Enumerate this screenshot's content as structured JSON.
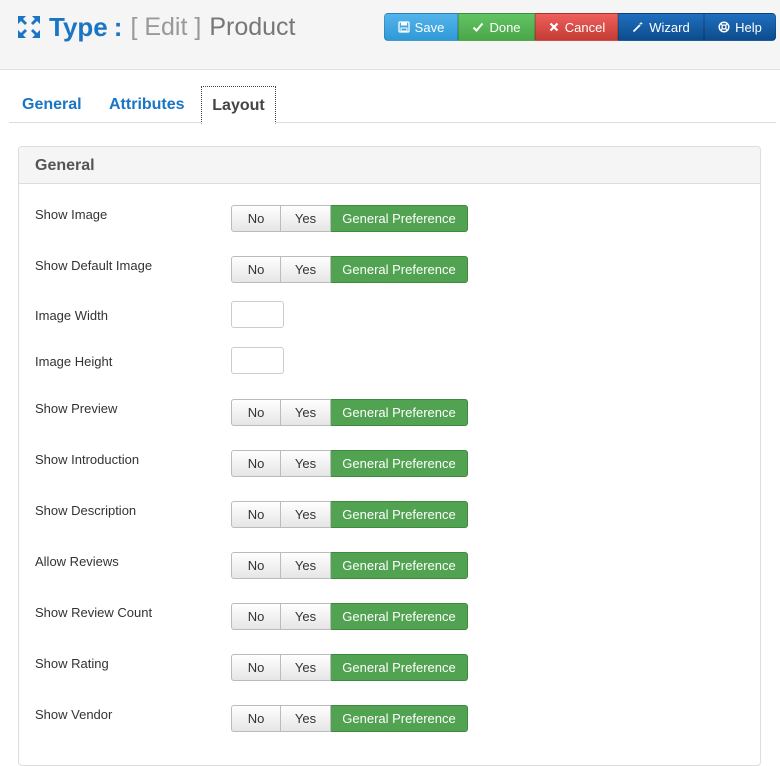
{
  "header": {
    "type_label": "Type",
    "colon": ":",
    "edit_label": "[ Edit ]",
    "entity_label": "Product"
  },
  "toolbar": {
    "save": "Save",
    "done": "Done",
    "cancel": "Cancel",
    "wizard": "Wizard",
    "help": "Help"
  },
  "tabs": [
    {
      "label": "General"
    },
    {
      "label": "Attributes"
    },
    {
      "label": "Layout",
      "active": true
    }
  ],
  "panel": {
    "title": "General",
    "options": [
      "No",
      "Yes",
      "General Preference"
    ],
    "fields": [
      {
        "label": "Show Image",
        "kind": "segmented",
        "selected": "General Preference"
      },
      {
        "label": "Show Default Image",
        "kind": "segmented",
        "selected": "General Preference"
      },
      {
        "label": "Image Width",
        "kind": "text",
        "value": ""
      },
      {
        "label": "Image Height",
        "kind": "text",
        "value": ""
      },
      {
        "label": "Show Preview",
        "kind": "segmented",
        "selected": "General Preference"
      },
      {
        "label": "Show Introduction",
        "kind": "segmented",
        "selected": "General Preference"
      },
      {
        "label": "Show Description",
        "kind": "segmented",
        "selected": "General Preference"
      },
      {
        "label": "Allow Reviews",
        "kind": "segmented",
        "selected": "General Preference"
      },
      {
        "label": "Show Review Count",
        "kind": "segmented",
        "selected": "General Preference"
      },
      {
        "label": "Show Rating",
        "kind": "segmented",
        "selected": "General Preference"
      },
      {
        "label": "Show Vendor",
        "kind": "segmented",
        "selected": "General Preference"
      }
    ]
  },
  "colors": {
    "brand_blue": "#1a75c4",
    "selected_green": "#51a351",
    "save": "#2f9ad6",
    "done": "#4aa64a",
    "cancel": "#c43c35",
    "wizard_help": "#0d4c8c"
  }
}
